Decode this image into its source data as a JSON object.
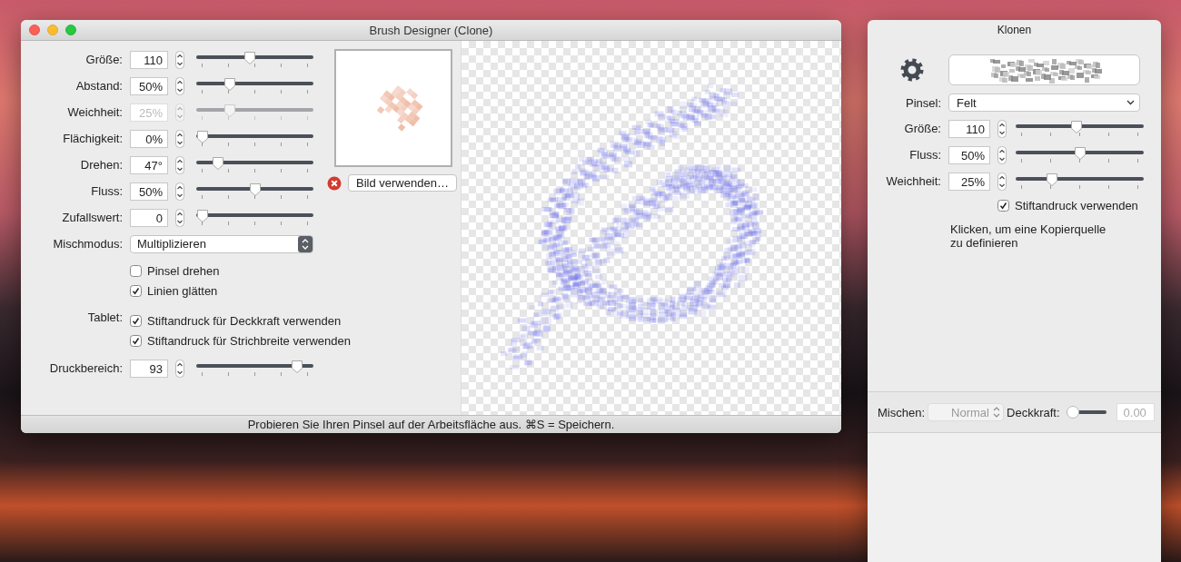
{
  "window": {
    "title": "Brush Designer (Clone)"
  },
  "settings": [
    {
      "label": "Größe:",
      "value": "110",
      "level": 0.45,
      "disabled": false
    },
    {
      "label": "Abstand:",
      "value": "50%",
      "level": 0.26,
      "disabled": false
    },
    {
      "label": "Weichheit:",
      "value": "25%",
      "level": 0.26,
      "disabled": true
    },
    {
      "label": "Flächigkeit:",
      "value": "0%",
      "level": 0,
      "disabled": false
    },
    {
      "label": "Drehen:",
      "value": "47°",
      "level": 0.15,
      "disabled": false
    },
    {
      "label": "Fluss:",
      "value": "50%",
      "level": 0.5,
      "disabled": false
    },
    {
      "label": "Zufallswert:",
      "value": "0",
      "level": 0,
      "disabled": false
    }
  ],
  "blend_mode": {
    "label": "Mischmodus:",
    "value": "Multiplizieren"
  },
  "options": [
    {
      "label": "Pinsel drehen",
      "checked": false
    },
    {
      "label": "Linien glätten",
      "checked": true
    }
  ],
  "tablet": {
    "label": "Tablet:",
    "options": [
      {
        "label": "Stiftandruck für Deckkraft verwenden",
        "checked": true
      },
      {
        "label": "Stiftandruck für Strichbreite verwenden",
        "checked": true
      }
    ]
  },
  "pressure_range": {
    "label": "Druckbereich:",
    "value": "93",
    "level": 0.9,
    "disabled": false
  },
  "image_button": "Bild verwenden…",
  "status_bar": "Probieren Sie Ihren Pinsel auf der Arbeitsfläche aus. ⌘S = Speichern.",
  "clone_panel": {
    "title": "Klonen",
    "brush": {
      "label": "Pinsel:",
      "value": "Felt"
    },
    "settings": [
      {
        "label": "Größe:",
        "value": "110",
        "level": 0.47,
        "disabled": false
      },
      {
        "label": "Fluss:",
        "value": "50%",
        "level": 0.5,
        "disabled": false
      },
      {
        "label": "Weichheit:",
        "value": "25%",
        "level": 0.26,
        "disabled": false
      }
    ],
    "pressure": {
      "label": "Stiftandruck verwenden",
      "checked": true
    },
    "hint": "Klicken, um eine Kopierquelle zu definieren"
  },
  "layer_bar": {
    "blend_label": "Mischen:",
    "blend_value": "Normal",
    "opacity_label": "Deckkraft:",
    "opacity": {
      "level": 0,
      "value": "0.00"
    }
  }
}
